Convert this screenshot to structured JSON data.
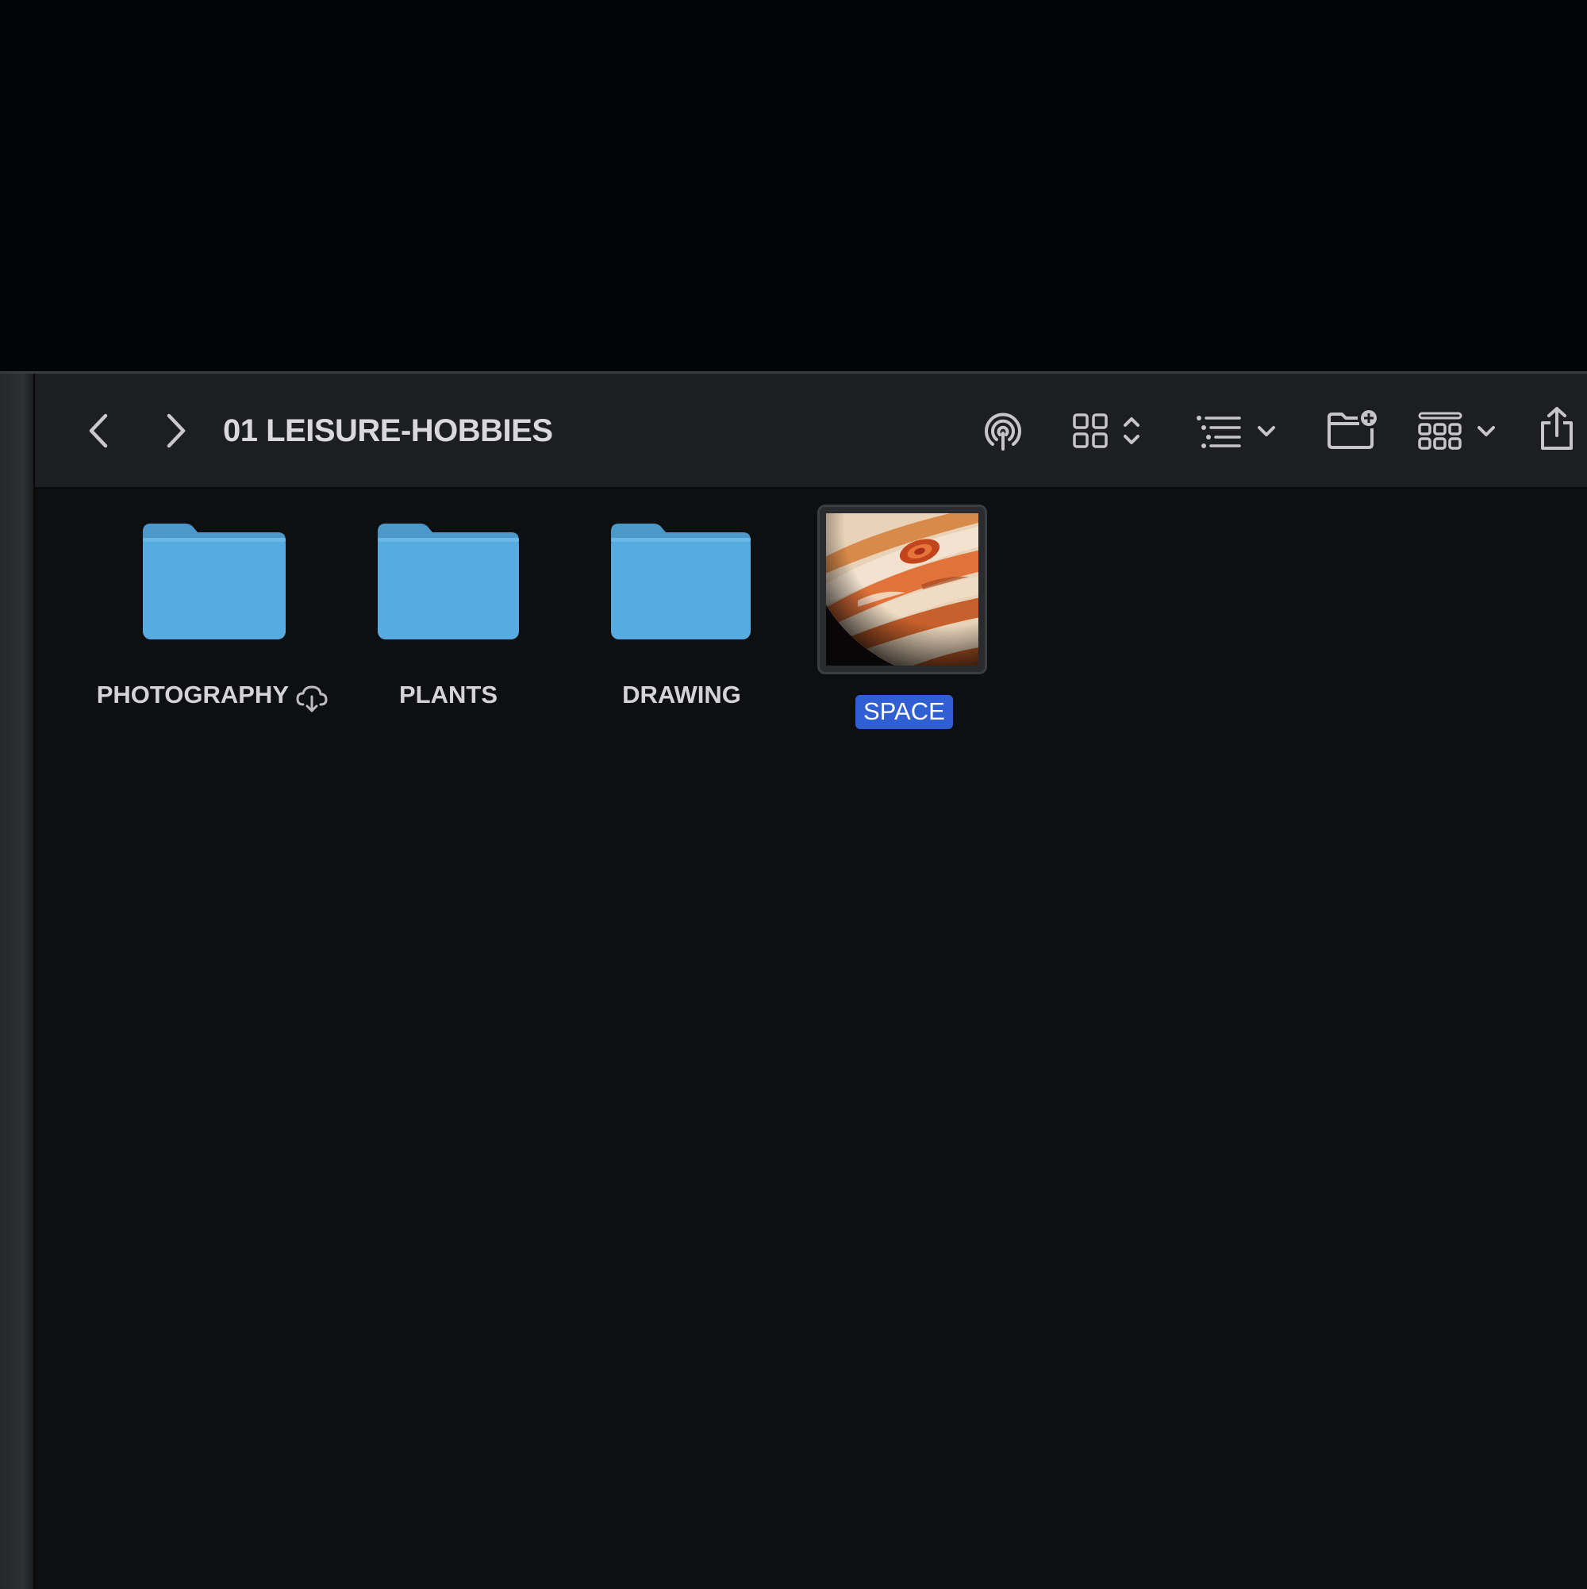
{
  "window": {
    "title": "01 LEISURE-HOBBIES"
  },
  "toolbar": {
    "back_icon": "chevron-left-icon",
    "forward_icon": "chevron-right-icon",
    "airdrop_icon": "airdrop-icon",
    "view_icon": "icon-grid-view-icon",
    "sort_icon": "list-sort-icon",
    "new_folder_icon": "new-folder-icon",
    "group_icon": "group-grid-icon",
    "share_icon": "share-icon"
  },
  "items": [
    {
      "name": "PHOTOGRAPHY",
      "kind": "folder",
      "status_icon": "icloud-download-icon",
      "selected": false
    },
    {
      "name": "PLANTS",
      "kind": "folder",
      "selected": false
    },
    {
      "name": "DRAWING",
      "kind": "folder",
      "selected": false
    },
    {
      "name": "SPACE",
      "kind": "image",
      "thumbnail": "jupiter",
      "selected": true
    }
  ],
  "colors": {
    "folder": "#56ace0",
    "selection": "#2f5fd3",
    "background": "#0e0f11",
    "toolbar": "#1d1e21"
  }
}
